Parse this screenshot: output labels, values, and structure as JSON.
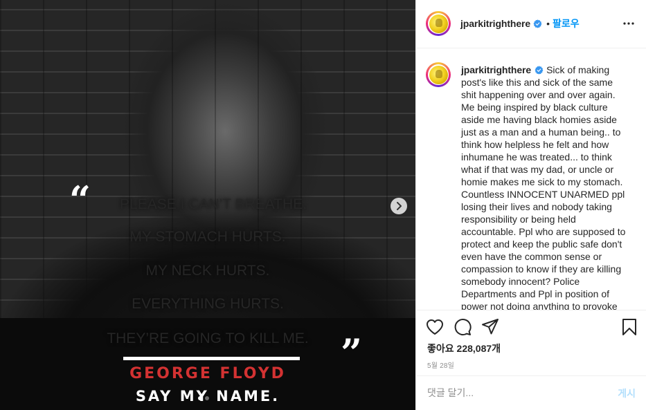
{
  "media": {
    "quote_lines": [
      "PLEASE I CAN’T BREATHE.",
      "MY STOMACH HURTS.",
      "MY NECK HURTS.",
      "EVERYTHING HURTS.",
      "THEY’RE GOING TO KILL ME."
    ],
    "open_quote": "“",
    "close_quote": "”",
    "name": "GEORGE FLOYD",
    "tagline": "SAY MY NAME.",
    "name_color": "#d33232",
    "carousel_dots": 2,
    "active_dot": 0
  },
  "header": {
    "username": "jparkitrighthere",
    "verified": true,
    "separator": "•",
    "follow_label": "팔로우",
    "more_icon": "more-horizontal-icon"
  },
  "caption": {
    "username": "jparkitrighthere",
    "verified": true,
    "text": "Sick of making post's like this and sick of the same shit happening over and over again. Me being inspired by black culture aside me having black homies aside just as a man and a human being.. to think how helpless he felt and how inhumane he was treated... to think what if that was my dad, or uncle or homie makes me sick to my stomach. Countless INNOCENT UNARMED ppl losing their lives and nobody taking responsibility or being held accountable. Ppl who are supposed to protect and keep the public safe don't even have the common sense or compassion to know if they are killing somebody innocent? Police Departments and Ppl in position of power not doing anything to provoke"
  },
  "actions": {
    "icons": [
      "heart-icon",
      "comment-icon",
      "share-icon",
      "bookmark-icon"
    ],
    "likes_label": "좋아요 228,087개",
    "date": "5월 28일"
  },
  "comment": {
    "placeholder": "댓글 달기...",
    "post_label": "게시"
  },
  "colors": {
    "accent": "#0095f6",
    "verified": "#3897f0",
    "muted": "#8e8e8e"
  }
}
